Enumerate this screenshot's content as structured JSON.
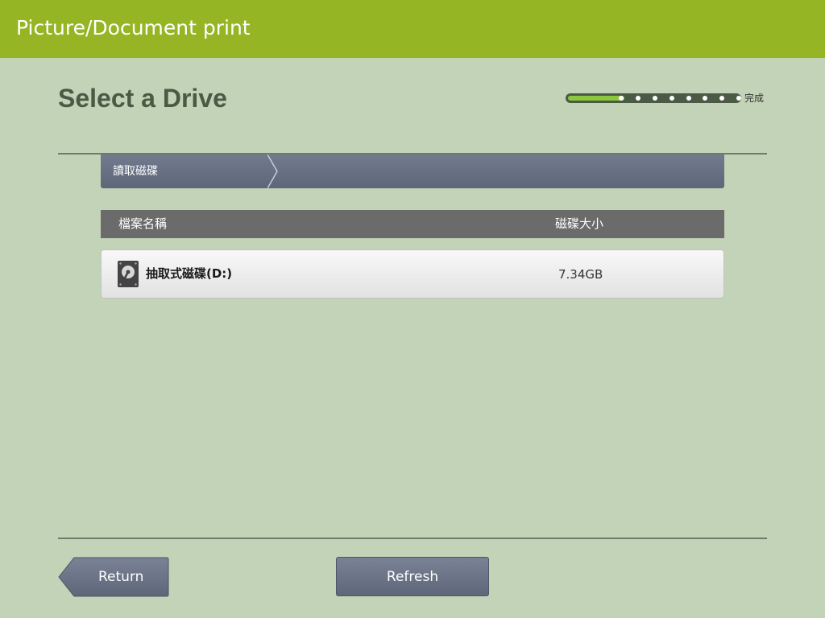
{
  "app": {
    "title": "Picture/Document print"
  },
  "page": {
    "title": "Select a Drive"
  },
  "progress": {
    "total_steps": 11,
    "completed_steps": 1,
    "end_label": "完成",
    "fill_color": "#8dc63f",
    "track_color": "#4a5a45"
  },
  "breadcrumb": {
    "items": [
      {
        "label": "讀取磁碟"
      }
    ]
  },
  "table": {
    "headers": {
      "name": "檔案名稱",
      "size": "磁碟大小"
    },
    "rows": [
      {
        "icon": "hard-drive-icon",
        "name": "抽取式磁碟(D:)",
        "size": "7.34GB"
      }
    ]
  },
  "footer": {
    "return_label": "Return",
    "refresh_label": "Refresh"
  },
  "colors": {
    "title_bar": "#95b524",
    "background": "#c2d3b7",
    "accent_button": "#666e82"
  }
}
